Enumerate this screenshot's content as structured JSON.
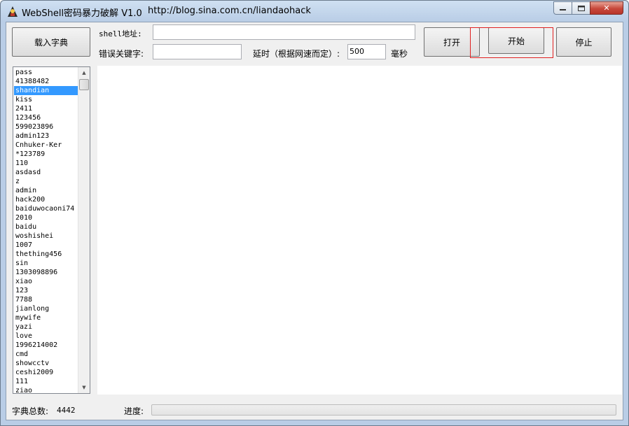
{
  "window": {
    "title": "WebShell密码暴力破解 V1.0",
    "url": "http://blog.sina.com.cn/liandaohack",
    "close_label": "✕"
  },
  "toolbar": {
    "load_dict_label": "载入字典",
    "open_label": "打开",
    "start_label": "开始",
    "stop_label": "停止"
  },
  "form": {
    "shell_label": "shell地址:",
    "shell_value": "",
    "error_keyword_label": "错误关键字:",
    "error_keyword_value": "",
    "delay_label": "延时（根据网速而定）:",
    "delay_value": "500",
    "delay_unit": "毫秒"
  },
  "dictionary": {
    "selected_index": 2,
    "items": [
      "pass",
      "41388482",
      "shandian",
      "kiss",
      "2411",
      "123456",
      "599023896",
      "admin123",
      "Cnhuker-Ker",
      "*123789",
      "110",
      "asdasd",
      "z",
      "admin",
      "hack200",
      "baiduwocaoni74",
      "2010",
      "baidu",
      "woshishei",
      "1007",
      "thething456",
      "sin",
      "1303098896",
      "xiao",
      "123",
      "7788",
      "jianlong",
      "mywife",
      "yazi",
      "love",
      "1996214002",
      "cmd",
      "showcctv",
      "ceshi2009",
      "111",
      "ziao"
    ]
  },
  "status": {
    "dict_total_label": "字典总数:",
    "dict_total_value": "4442",
    "progress_label": "进度:",
    "progress_fraction": 0
  },
  "colors": {
    "selection": "#3399ff",
    "highlight_box": "#e02020",
    "progress_fill": "#06b025"
  }
}
